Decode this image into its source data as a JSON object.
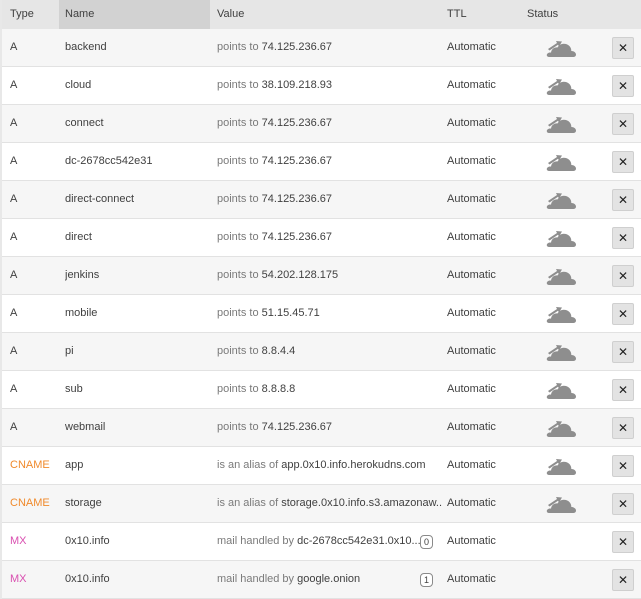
{
  "columns": {
    "type": "Type",
    "name": "Name",
    "value": "Value",
    "ttl": "TTL",
    "status": "Status"
  },
  "colors": {
    "A": "#404040",
    "CNAME": "#f08a2c",
    "MX": "#d94fb0",
    "cloud": "#8e8e8e"
  },
  "records": [
    {
      "type": "A",
      "name": "backend",
      "value_prefix": "points to",
      "value": "74.125.236.67",
      "ttl": "Automatic",
      "status_icon": "cloud-icon",
      "delete_label": "✕"
    },
    {
      "type": "A",
      "name": "cloud",
      "value_prefix": "points to",
      "value": "38.109.218.93",
      "ttl": "Automatic",
      "status_icon": "cloud-icon",
      "delete_label": "✕"
    },
    {
      "type": "A",
      "name": "connect",
      "value_prefix": "points to",
      "value": "74.125.236.67",
      "ttl": "Automatic",
      "status_icon": "cloud-icon",
      "delete_label": "✕"
    },
    {
      "type": "A",
      "name": "dc-2678cc542e31",
      "value_prefix": "points to",
      "value": "74.125.236.67",
      "ttl": "Automatic",
      "status_icon": "cloud-icon",
      "delete_label": "✕"
    },
    {
      "type": "A",
      "name": "direct-connect",
      "value_prefix": "points to",
      "value": "74.125.236.67",
      "ttl": "Automatic",
      "status_icon": "cloud-icon",
      "delete_label": "✕"
    },
    {
      "type": "A",
      "name": "direct",
      "value_prefix": "points to",
      "value": "74.125.236.67",
      "ttl": "Automatic",
      "status_icon": "cloud-icon",
      "delete_label": "✕"
    },
    {
      "type": "A",
      "name": "jenkins",
      "value_prefix": "points to",
      "value": "54.202.128.175",
      "ttl": "Automatic",
      "status_icon": "cloud-icon",
      "delete_label": "✕"
    },
    {
      "type": "A",
      "name": "mobile",
      "value_prefix": "points to",
      "value": "51.15.45.71",
      "ttl": "Automatic",
      "status_icon": "cloud-icon",
      "delete_label": "✕"
    },
    {
      "type": "A",
      "name": "pi",
      "value_prefix": "points to",
      "value": "8.8.4.4",
      "ttl": "Automatic",
      "status_icon": "cloud-icon",
      "delete_label": "✕"
    },
    {
      "type": "A",
      "name": "sub",
      "value_prefix": "points to",
      "value": "8.8.8.8",
      "ttl": "Automatic",
      "status_icon": "cloud-icon",
      "delete_label": "✕"
    },
    {
      "type": "A",
      "name": "webmail",
      "value_prefix": "points to",
      "value": "74.125.236.67",
      "ttl": "Automatic",
      "status_icon": "cloud-icon",
      "delete_label": "✕"
    },
    {
      "type": "CNAME",
      "name": "app",
      "value_prefix": "is an alias of",
      "value": "app.0x10.info.herokudns.com",
      "ttl": "Automatic",
      "status_icon": "cloud-icon",
      "delete_label": "✕"
    },
    {
      "type": "CNAME",
      "name": "storage",
      "value_prefix": "is an alias of",
      "value": "storage.0x10.info.s3.amazonaw...",
      "ttl": "Automatic",
      "status_icon": "cloud-icon",
      "delete_label": "✕"
    },
    {
      "type": "MX",
      "name": "0x10.info",
      "value_prefix": "mail handled by",
      "value": "dc-2678cc542e31.0x10....",
      "priority": "0",
      "ttl": "Automatic",
      "delete_label": "✕"
    },
    {
      "type": "MX",
      "name": "0x10.info",
      "value_prefix": "mail handled by",
      "value": "google.onion",
      "priority": "1",
      "ttl": "Automatic",
      "delete_label": "✕"
    }
  ]
}
